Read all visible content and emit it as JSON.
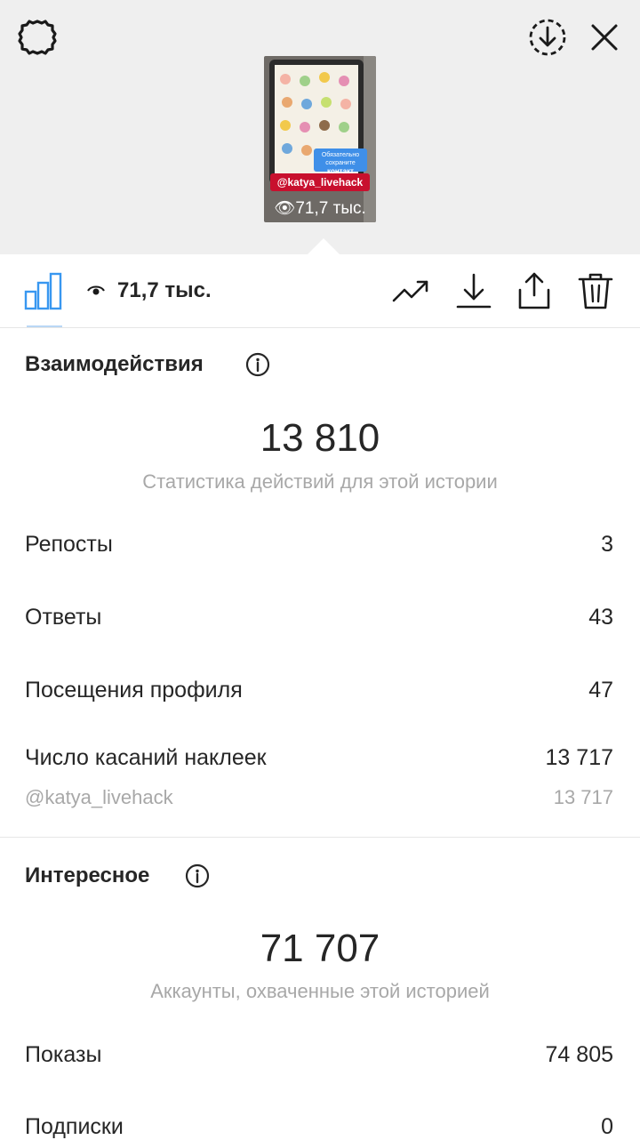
{
  "story_preview": {
    "mention_sticker": "@katya_livehack",
    "sticker_text": "Обязательно сохраните",
    "sticker_button": "контакт",
    "views": "71,7 тыс."
  },
  "toolbar": {
    "views": "71,7 тыс."
  },
  "interactions": {
    "title": "Взаимодействия",
    "total": "13 810",
    "caption": "Статистика действий для этой истории",
    "rows": [
      {
        "label": "Репосты",
        "value": "3"
      },
      {
        "label": "Ответы",
        "value": "43"
      },
      {
        "label": "Посещения профиля",
        "value": "47"
      },
      {
        "label": "Число касаний наклеек",
        "value": "13 717"
      }
    ],
    "sub_row": {
      "label": "@katya_livehack",
      "value": "13 717"
    }
  },
  "discovery": {
    "title": "Интересное",
    "total": "71 707",
    "caption": "Аккаунты, охваченные этой историей",
    "rows": [
      {
        "label": "Показы",
        "value": "74 805"
      },
      {
        "label": "Подписки",
        "value": "0"
      }
    ]
  },
  "colors": {
    "accent": "#3897f0",
    "mention_red": "#c8102e",
    "muted_text": "#a8a8a8"
  }
}
